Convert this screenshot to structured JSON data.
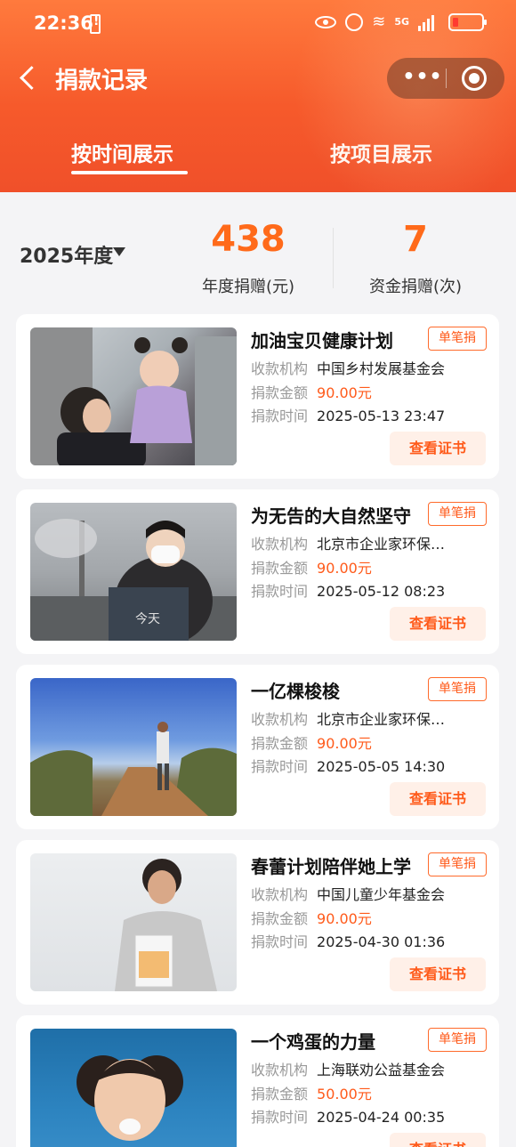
{
  "status_bar": {
    "time": "22:36",
    "network": "5G",
    "icons": [
      "alert-icon",
      "eye-icon",
      "alarm-icon",
      "wifi-icon",
      "signal-icon",
      "battery-icon"
    ]
  },
  "nav": {
    "title": "捐款记录",
    "back_icon": "back-icon",
    "more_icon": "more-icon",
    "target_icon": "target-icon"
  },
  "tabs": [
    {
      "label": "按时间展示",
      "active": true
    },
    {
      "label": "按项目展示",
      "active": false
    }
  ],
  "summary": {
    "year": "2025年度",
    "stats": [
      {
        "value": "438",
        "label": "年度捐赠(元)"
      },
      {
        "value": "7",
        "label": "资金捐赠(次)"
      }
    ]
  },
  "labels": {
    "org": "收款机构",
    "amount": "捐款金额",
    "time": "捐款时间",
    "badge": "单笔捐",
    "cert": "查看证书"
  },
  "records": [
    {
      "title": "加油宝贝健康计划",
      "org": "中国乡村发展基金会",
      "amount": "90.00元",
      "time": "2025-05-13 23:47"
    },
    {
      "title": "为无告的大自然坚守",
      "org": "北京市企业家环保…",
      "amount": "90.00元",
      "time": "2025-05-12 08:23"
    },
    {
      "title": "一亿棵梭梭",
      "org": "北京市企业家环保…",
      "amount": "90.00元",
      "time": "2025-05-05 14:30"
    },
    {
      "title": "春蕾计划陪伴她上学",
      "org": "中国儿童少年基金会",
      "amount": "90.00元",
      "time": "2025-04-30 01:36"
    },
    {
      "title": "一个鸡蛋的力量",
      "org": "上海联劝公益基金会",
      "amount": "50.00元",
      "time": "2025-04-24 00:35"
    }
  ],
  "colors": {
    "accent": "#ff6a1a",
    "header": "#f65a2b",
    "background": "#f4f4f6"
  }
}
